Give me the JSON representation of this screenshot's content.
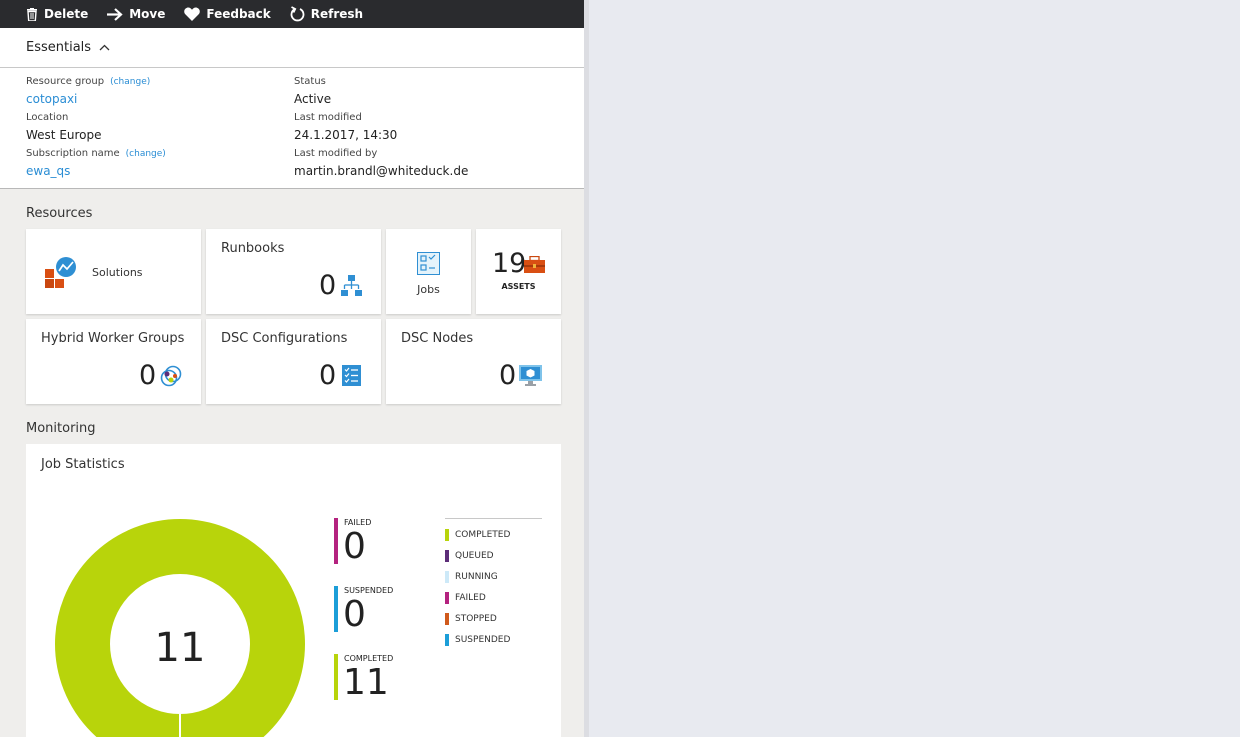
{
  "toolbar": {
    "delete": "Delete",
    "move": "Move",
    "feedback": "Feedback",
    "refresh": "Refresh"
  },
  "essentials": {
    "title": "Essentials",
    "resource_group_label": "Resource group",
    "resource_group_change": "(change)",
    "resource_group_value": "cotopaxi",
    "location_label": "Location",
    "location_value": "West Europe",
    "subscription_label": "Subscription name",
    "subscription_change": "(change)",
    "subscription_value": "ewa_qs",
    "status_label": "Status",
    "status_value": "Active",
    "last_modified_label": "Last modified",
    "last_modified_value": "24.1.2017, 14:30",
    "last_modified_by_label": "Last modified by",
    "last_modified_by_value": "martin.brandl@whiteduck.de"
  },
  "resources": {
    "title": "Resources",
    "solutions": "Solutions",
    "runbooks": {
      "label": "Runbooks",
      "count": "0"
    },
    "jobs": "Jobs",
    "assets": {
      "label": "ASSETS",
      "count": "19"
    },
    "hybrid": {
      "label": "Hybrid Worker Groups",
      "count": "0"
    },
    "dsc_config": {
      "label": "DSC Configurations",
      "count": "0"
    },
    "dsc_nodes": {
      "label": "DSC Nodes",
      "count": "0"
    }
  },
  "monitoring": {
    "title": "Monitoring",
    "job_stats_title": "Job Statistics",
    "total": "11",
    "stats": [
      {
        "label": "FAILED",
        "value": "0",
        "color": "#b4227f"
      },
      {
        "label": "SUSPENDED",
        "value": "0",
        "color": "#1c9ed8"
      },
      {
        "label": "COMPLETED",
        "value": "11",
        "color": "#b8d40b"
      }
    ],
    "legend": [
      {
        "label": "COMPLETED",
        "color": "#b8d40b"
      },
      {
        "label": "QUEUED",
        "color": "#5c2d78"
      },
      {
        "label": "RUNNING",
        "color": "#cde9f8"
      },
      {
        "label": "FAILED",
        "color": "#b4227f"
      },
      {
        "label": "STOPPED",
        "color": "#d05a1c"
      },
      {
        "label": "SUSPENDED",
        "color": "#1c9ed8"
      }
    ]
  }
}
